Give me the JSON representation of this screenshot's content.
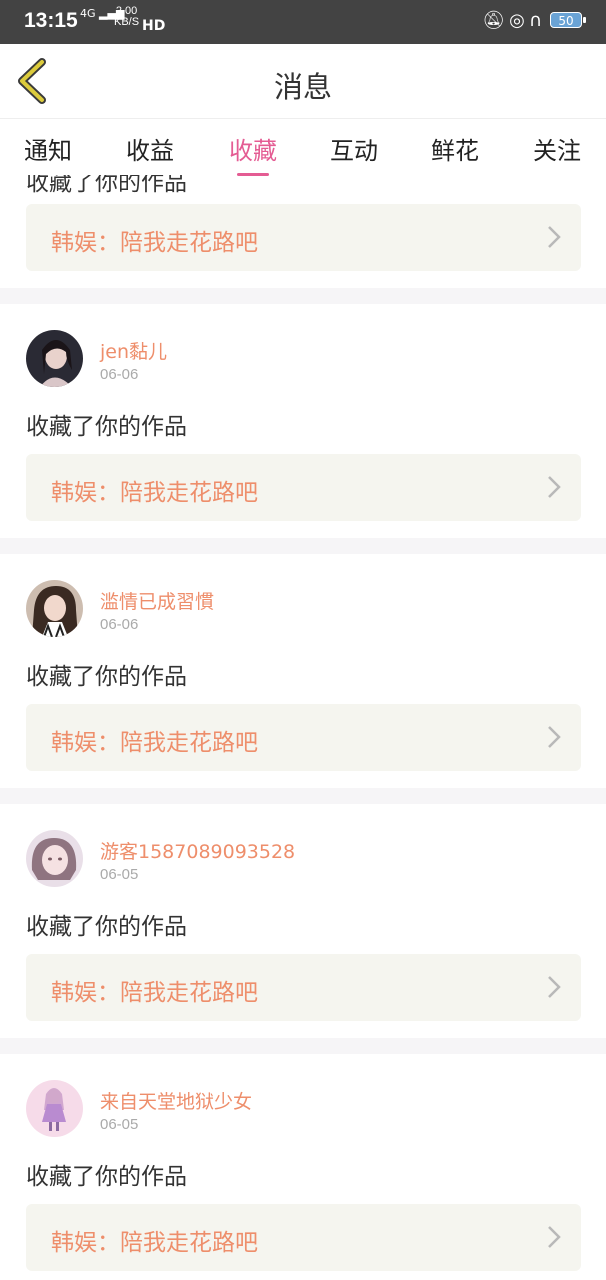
{
  "status": {
    "time": "13:15",
    "network": "4G",
    "speed_top": "2.00",
    "speed_bottom": "KB/S",
    "hd": "HD",
    "battery": "50"
  },
  "header": {
    "title": "消息"
  },
  "tabs": [
    {
      "label": "通知"
    },
    {
      "label": "收益"
    },
    {
      "label": "收藏"
    },
    {
      "label": "互动"
    },
    {
      "label": "鲜花"
    },
    {
      "label": "关注"
    }
  ],
  "partial": {
    "action": "收藏了你的作品",
    "work": "韩娱：陪我走花路吧"
  },
  "items": [
    {
      "name": "jen黏儿",
      "date": "06-06",
      "action": "收藏了你的作品",
      "work": "韩娱：陪我走花路吧"
    },
    {
      "name": "滥情已成習慣",
      "date": "06-06",
      "action": "收藏了你的作品",
      "work": "韩娱：陪我走花路吧"
    },
    {
      "name": "游客1587089093528",
      "date": "06-05",
      "action": "收藏了你的作品",
      "work": "韩娱：陪我走花路吧"
    },
    {
      "name": "来自天堂地狱少女",
      "date": "06-05",
      "action": "收藏了你的作品",
      "work": "韩娱：陪我走花路吧"
    }
  ],
  "colors": {
    "accent": "#e45c93",
    "link": "#ee8e6b",
    "card_bg": "#f5f5ef",
    "back_arrow": "#d8c83a"
  }
}
